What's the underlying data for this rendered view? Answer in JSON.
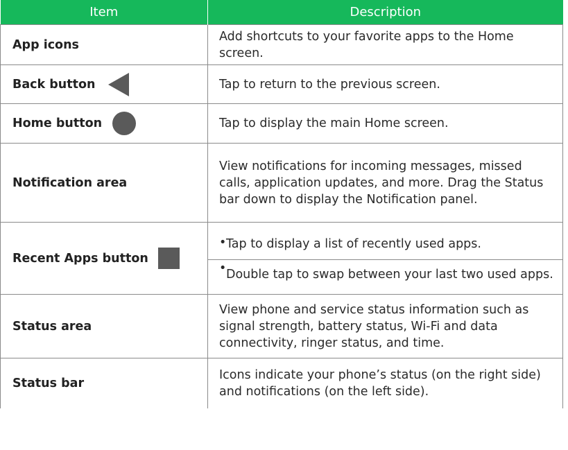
{
  "table": {
    "header": {
      "item": "Item",
      "description": "Description"
    },
    "rows": [
      {
        "item": "App icons",
        "icon": "",
        "description": "Add shortcuts to your favorite apps to the Home screen."
      },
      {
        "item": "Back button",
        "icon": "back-triangle-icon",
        "description": "Tap to return to the previous screen."
      },
      {
        "item": "Home button",
        "icon": "home-circle-icon",
        "description": "Tap to display the main Home screen."
      },
      {
        "item": "Notification area",
        "icon": "",
        "description": "View notifications for incoming messages, missed calls, application updates, and more. Drag the Status bar down to display the Notification panel."
      },
      {
        "item": "Recent Apps button",
        "icon": "recent-square-icon",
        "bullets": [
          "Tap to display a list of recently used apps.",
          "Double tap to swap between your last two used apps."
        ]
      },
      {
        "item": "Status area",
        "icon": "",
        "description": "View phone and service status information such as signal strength, battery status, Wi-Fi and data connectivity, ringer status, and time."
      },
      {
        "item": "Status bar",
        "icon": "",
        "description": "Icons indicate your phone’s status (on the right side) and notifications (on the left side)."
      }
    ]
  },
  "colors": {
    "header_bg": "#16b85b",
    "icon": "#5a5a5a",
    "border": "#8a8a8a"
  }
}
